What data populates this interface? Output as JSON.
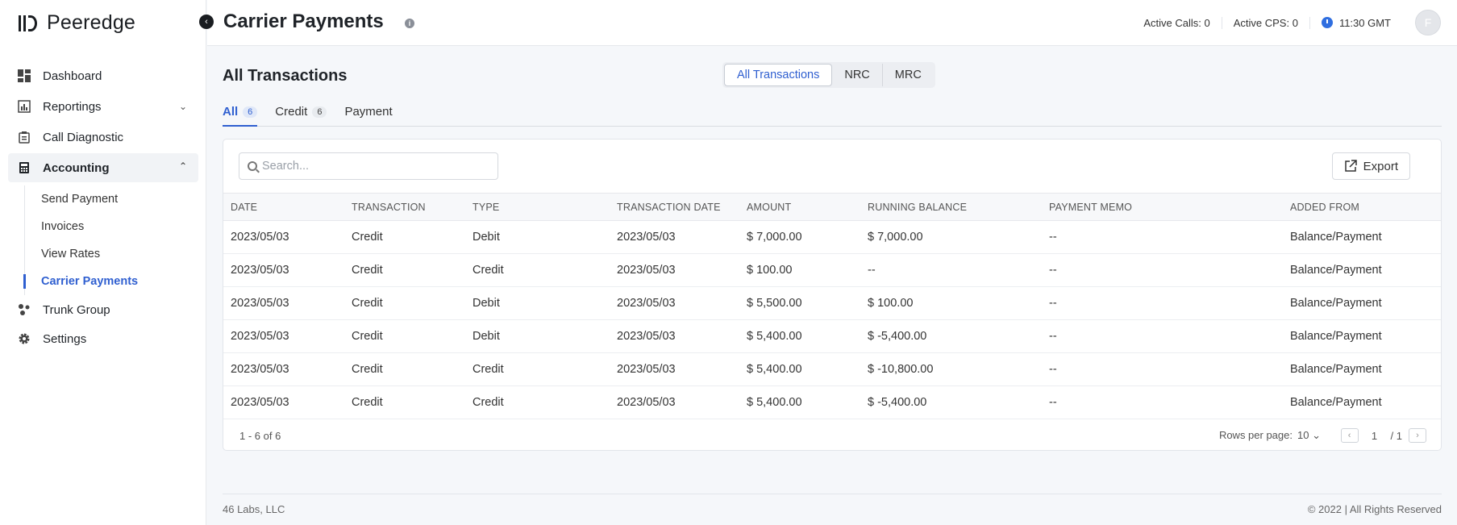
{
  "brand": {
    "name": "Peeredge"
  },
  "sidebar": {
    "items": [
      {
        "label": "Dashboard"
      },
      {
        "label": "Reportings"
      },
      {
        "label": "Call Diagnostic"
      },
      {
        "label": "Accounting"
      },
      {
        "label": "Trunk Group"
      },
      {
        "label": "Settings"
      }
    ],
    "accounting_sub": [
      {
        "label": "Send Payment"
      },
      {
        "label": "Invoices"
      },
      {
        "label": "View Rates"
      },
      {
        "label": "Carrier Payments"
      }
    ]
  },
  "header": {
    "title": "Carrier Payments",
    "active_calls": "Active Calls: 0",
    "active_cps": "Active CPS: 0",
    "time": "11:30 GMT",
    "avatar_initial": "F"
  },
  "section": {
    "title": "All Transactions",
    "segments": [
      "All Transactions",
      "NRC",
      "MRC"
    ],
    "tabs": [
      {
        "label": "All",
        "count": "6"
      },
      {
        "label": "Credit",
        "count": "6"
      },
      {
        "label": "Payment",
        "count": ""
      }
    ]
  },
  "search": {
    "placeholder": "Search..."
  },
  "export_label": "Export",
  "table": {
    "columns": [
      "DATE",
      "TRANSACTION",
      "TYPE",
      "TRANSACTION DATE",
      "AMOUNT",
      "RUNNING BALANCE",
      "PAYMENT MEMO",
      "ADDED FROM"
    ],
    "rows": [
      [
        "2023/05/03",
        "Credit",
        "Debit",
        "2023/05/03",
        "$ 7,000.00",
        "$ 7,000.00",
        "--",
        "Balance/Payment"
      ],
      [
        "2023/05/03",
        "Credit",
        "Credit",
        "2023/05/03",
        "$ 100.00",
        "--",
        "--",
        "Balance/Payment"
      ],
      [
        "2023/05/03",
        "Credit",
        "Debit",
        "2023/05/03",
        "$ 5,500.00",
        "$ 100.00",
        "--",
        "Balance/Payment"
      ],
      [
        "2023/05/03",
        "Credit",
        "Debit",
        "2023/05/03",
        "$ 5,400.00",
        "$ -5,400.00",
        "--",
        "Balance/Payment"
      ],
      [
        "2023/05/03",
        "Credit",
        "Credit",
        "2023/05/03",
        "$ 5,400.00",
        "$ -10,800.00",
        "--",
        "Balance/Payment"
      ],
      [
        "2023/05/03",
        "Credit",
        "Credit",
        "2023/05/03",
        "$ 5,400.00",
        "$ -5,400.00",
        "--",
        "Balance/Payment"
      ]
    ]
  },
  "pager": {
    "range": "1 - 6 of 6",
    "rows_label": "Rows per page:",
    "rows_value": "10",
    "current": "1",
    "total": "/ 1"
  },
  "footer": {
    "left": "46 Labs, LLC",
    "right": "© 2022 | All Rights Reserved"
  },
  "colors": {
    "accent": "#2f5fd0"
  }
}
